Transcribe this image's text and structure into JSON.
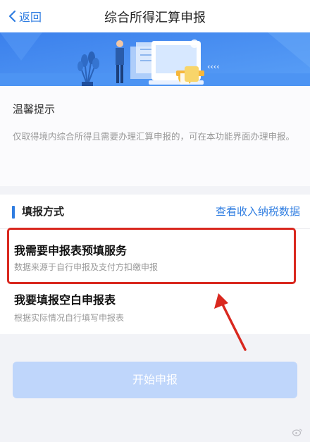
{
  "nav": {
    "back_label": "返回",
    "title": "综合所得汇算申报"
  },
  "tips": {
    "title": "温馨提示",
    "text": "仅取得境内综合所得且需要办理汇算申报的，可在本功能界面办理申报。"
  },
  "filing": {
    "section_title": "填报方式",
    "view_link": "查看收入纳税数据",
    "options": [
      {
        "title": "我需要申报表预填服务",
        "subtitle": "数据来源于自行申报及支付方扣缴申报"
      },
      {
        "title": "我要填报空白申报表",
        "subtitle": "根据实际情况自行填写申报表"
      }
    ]
  },
  "start_button": "开始申报",
  "colors": {
    "accent": "#2f7de1",
    "highlight": "#d9281f",
    "button_disabled": "#bfd6fb"
  },
  "icons": [
    "chevron-left-icon",
    "weibo-icon"
  ]
}
